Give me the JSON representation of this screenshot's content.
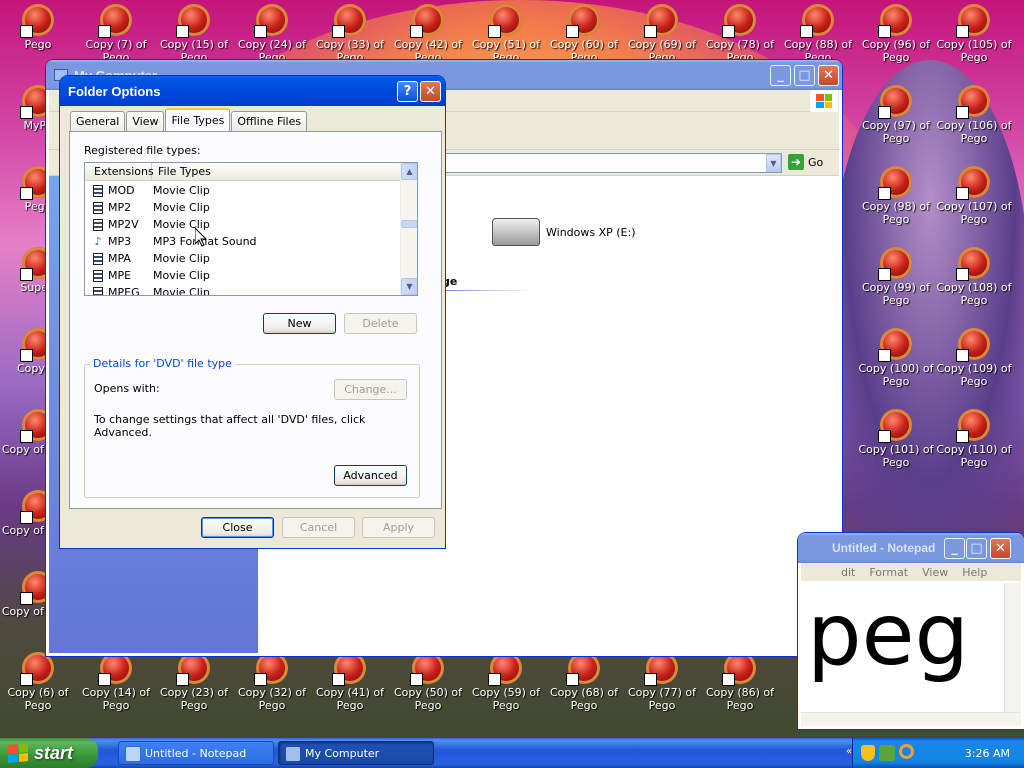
{
  "desktop": {
    "icons": [
      {
        "label": "Pego",
        "col": 0,
        "row": 0
      },
      {
        "label": "Copy (7) of Pego",
        "col": 1,
        "row": 0
      },
      {
        "label": "Copy (15) of Pego",
        "col": 2,
        "row": 0
      },
      {
        "label": "Copy (24) of Pego",
        "col": 3,
        "row": 0
      },
      {
        "label": "Copy (33) of Pego",
        "col": 4,
        "row": 0
      },
      {
        "label": "Copy (42) of Pego",
        "col": 5,
        "row": 0
      },
      {
        "label": "Copy (51) of Pego",
        "col": 6,
        "row": 0
      },
      {
        "label": "Copy (60) of Pego",
        "col": 7,
        "row": 0
      },
      {
        "label": "Copy (69) of Pego",
        "col": 8,
        "row": 0
      },
      {
        "label": "Copy (78) of Pego",
        "col": 9,
        "row": 0
      },
      {
        "label": "Copy (88) of Pego",
        "col": 10,
        "row": 0
      },
      {
        "label": "Copy (96) of Pego",
        "col": 11,
        "row": 0
      },
      {
        "label": "Copy (105) of Pego",
        "col": 12,
        "row": 0
      },
      {
        "label": "MyPa",
        "col": 0,
        "row": 1
      },
      {
        "label": "Pego",
        "col": 0,
        "row": 2
      },
      {
        "label": "Superl",
        "col": 0,
        "row": 3
      },
      {
        "label": "Copy of",
        "col": 0,
        "row": 4
      },
      {
        "label": "Copy of Pego",
        "col": 0,
        "row": 5
      },
      {
        "label": "Copy of Pego",
        "col": 0,
        "row": 6
      },
      {
        "label": "Copy of Pego",
        "col": 0,
        "row": 7
      },
      {
        "label": "Copy (97) of Pego",
        "col": 11,
        "row": 1
      },
      {
        "label": "Copy (106) of Pego",
        "col": 12,
        "row": 1
      },
      {
        "label": "Copy (98) of Pego",
        "col": 11,
        "row": 2
      },
      {
        "label": "Copy (107) of Pego",
        "col": 12,
        "row": 2
      },
      {
        "label": "Copy (99) of Pego",
        "col": 11,
        "row": 3
      },
      {
        "label": "Copy (108) of Pego",
        "col": 12,
        "row": 3
      },
      {
        "label": "Copy (100) of Pego",
        "col": 11,
        "row": 4
      },
      {
        "label": "Copy (109) of Pego",
        "col": 12,
        "row": 4
      },
      {
        "label": "Copy (101) of Pego",
        "col": 11,
        "row": 5
      },
      {
        "label": "Copy (110) of Pego",
        "col": 12,
        "row": 5
      },
      {
        "label": "Copy (6) of Pego",
        "col": 0,
        "row": 8
      },
      {
        "label": "Copy (14) of Pego",
        "col": 1,
        "row": 8
      },
      {
        "label": "Copy (23) of Pego",
        "col": 2,
        "row": 8
      },
      {
        "label": "Copy (32) of Pego",
        "col": 3,
        "row": 8
      },
      {
        "label": "Copy (41) of Pego",
        "col": 4,
        "row": 8
      },
      {
        "label": "Copy (50) of Pego",
        "col": 5,
        "row": 8
      },
      {
        "label": "Copy (59) of Pego",
        "col": 6,
        "row": 8
      },
      {
        "label": "Copy (68) of Pego",
        "col": 7,
        "row": 8
      },
      {
        "label": "Copy (77) of Pego",
        "col": 8,
        "row": 8
      },
      {
        "label": "Copy (86) of Pego",
        "col": 9,
        "row": 8
      }
    ]
  },
  "my_computer": {
    "title": "My Computer",
    "go_label": "Go",
    "drive_label": "Windows XP (E:)",
    "section_fragment": "ge"
  },
  "notepad": {
    "title": "Untitled - Notepad",
    "menu": [
      "dit",
      "Format",
      "View",
      "Help"
    ],
    "content": "peg"
  },
  "folder_options": {
    "title": "Folder Options",
    "tabs": [
      "General",
      "View",
      "File Types",
      "Offline Files"
    ],
    "selected_tab": "File Types",
    "registered_label": "Registered file types:",
    "columns": [
      "Extensions",
      "File Types"
    ],
    "rows": [
      {
        "ext": "MOD",
        "type": "Movie Clip",
        "icon": "movie-icon"
      },
      {
        "ext": "MP2",
        "type": "Movie Clip",
        "icon": "movie-icon"
      },
      {
        "ext": "MP2V",
        "type": "Movie Clip",
        "icon": "movie-icon"
      },
      {
        "ext": "MP3",
        "type": "MP3 Format Sound",
        "icon": "music-note-icon"
      },
      {
        "ext": "MPA",
        "type": "Movie Clip",
        "icon": "movie-icon"
      },
      {
        "ext": "MPE",
        "type": "Movie Clip",
        "icon": "movie-icon"
      },
      {
        "ext": "MPEG",
        "type": "Movie Clip",
        "icon": "movie-icon"
      }
    ],
    "new_label": "New",
    "delete_label": "Delete",
    "details_legend": "Details for 'DVD' file type",
    "opens_with_label": "Opens with:",
    "change_label": "Change...",
    "advanced_text": "To change settings that affect all 'DVD' files, click Advanced.",
    "advanced_label": "Advanced",
    "close_label": "Close",
    "cancel_label": "Cancel",
    "apply_label": "Apply",
    "help_glyph": "?",
    "close_glyph": "✕"
  },
  "taskbar": {
    "start_label": "start",
    "tasks": [
      {
        "label": "Untitled - Notepad",
        "active": false
      },
      {
        "label": "My Computer",
        "active": true
      }
    ],
    "clock": "3:26 AM"
  },
  "colors": {
    "xp_blue": "#0054e3",
    "dialog_face": "#ece9d8",
    "tab_highlight": "#ffc83c",
    "group_legend": "#0046d5",
    "start_green": "#379537"
  }
}
